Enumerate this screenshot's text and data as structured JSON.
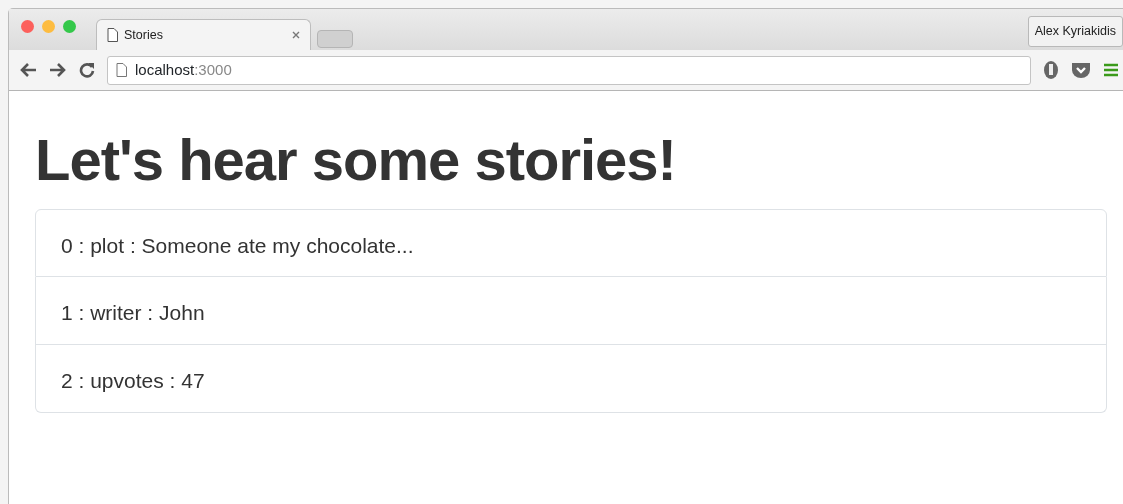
{
  "browser": {
    "tab": {
      "title": "Stories",
      "selected": true
    },
    "profile": "Alex Kyriakidis",
    "address": {
      "host": "localhost",
      "port": ":3000"
    }
  },
  "page": {
    "heading": "Let's hear some stories!",
    "items": [
      {
        "text": "0 : plot : Someone ate my chocolate..."
      },
      {
        "text": "1 : writer : John"
      },
      {
        "text": "2 : upvotes : 47"
      }
    ]
  }
}
